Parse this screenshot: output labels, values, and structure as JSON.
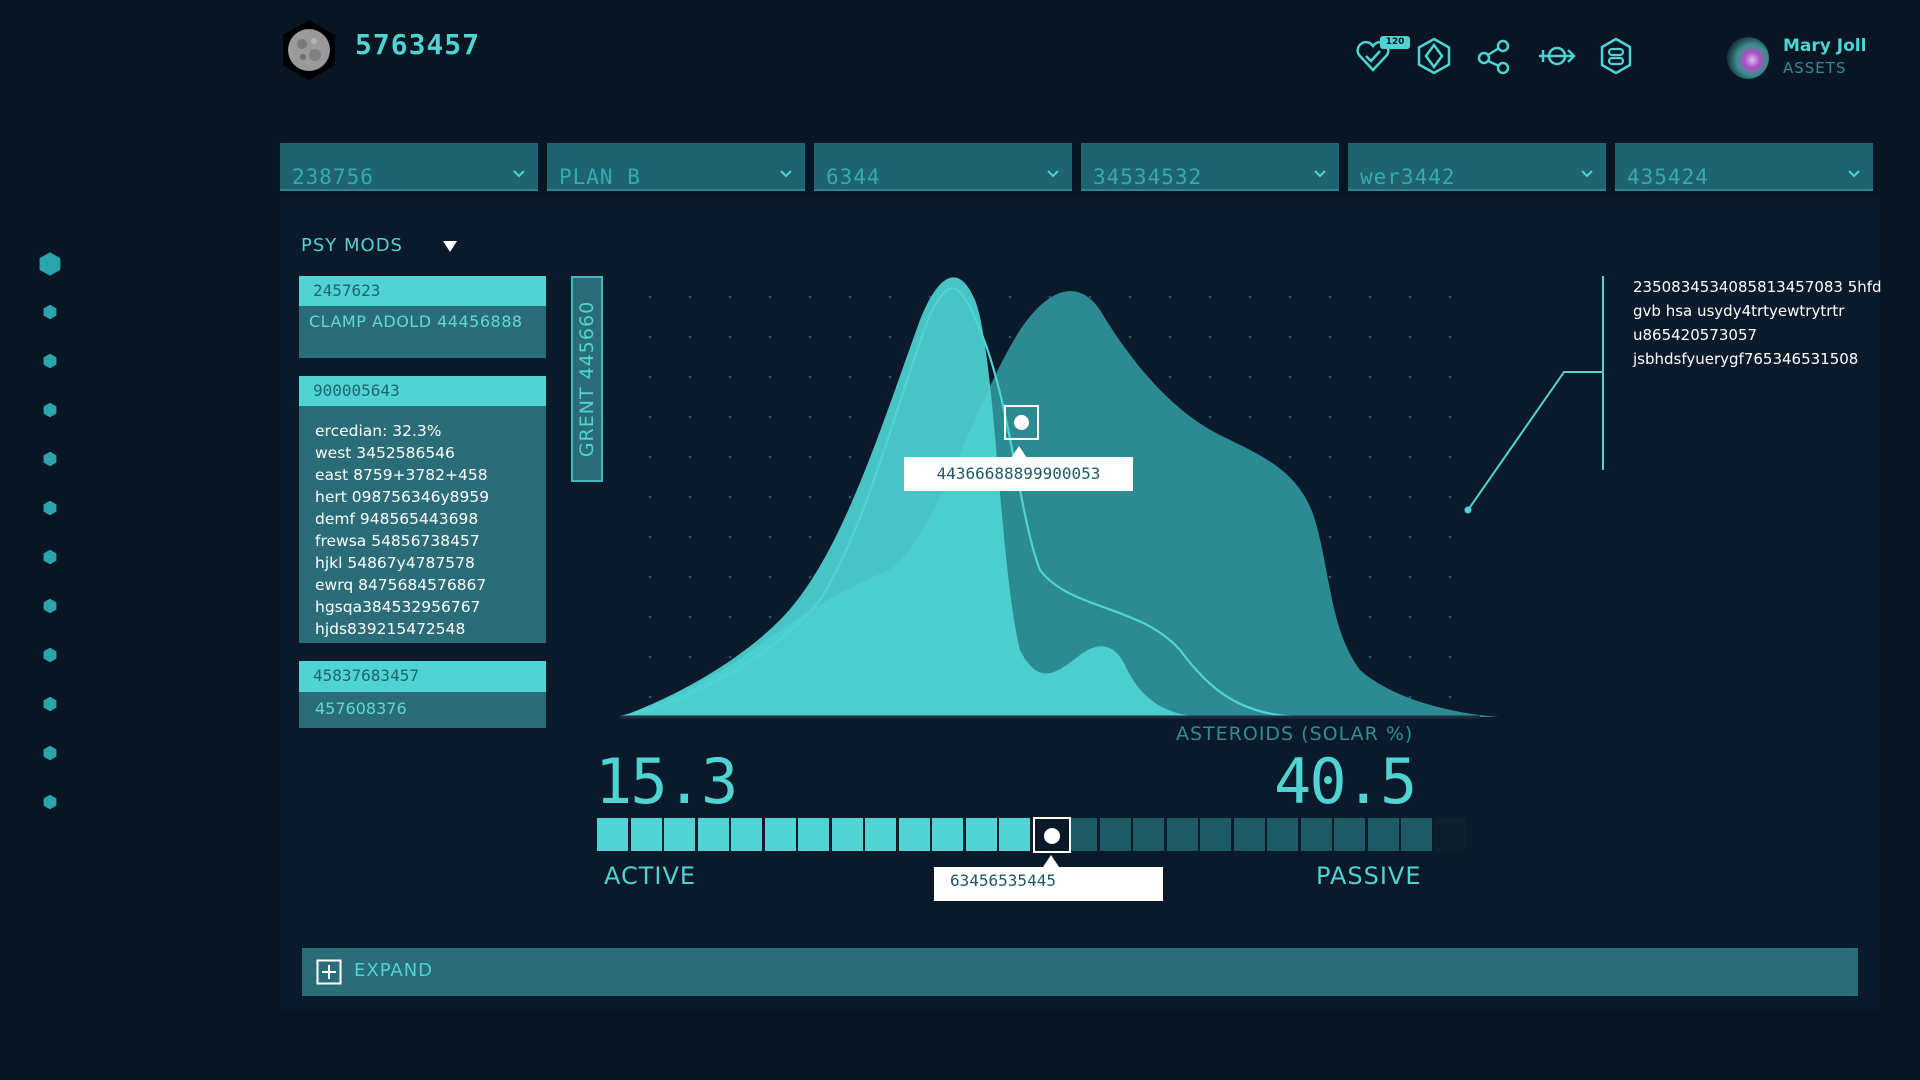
{
  "header": {
    "app_id": "5763457",
    "badge_count": "120",
    "icons": [
      "heart-icon",
      "hexagon-diamond-icon",
      "share-icon",
      "arrow-target-icon",
      "shield-icon"
    ],
    "user_name": "Mary Joll",
    "user_sub": "ASSETS"
  },
  "filters": [
    "238756",
    "PLAN B",
    "6344",
    "34534532",
    "wer3442",
    "435424"
  ],
  "mods": {
    "title": "PSY MODS",
    "card1": {
      "head": "2457623",
      "body": "CLAMP ADOLD 44456888"
    },
    "card2": {
      "head": "900005643",
      "lines": [
        "ercedian: 32.3%",
        "west 3452586546",
        "east 8759+3782+458",
        "hert 098756346y8959",
        "demf 948565443698",
        "frewsa 54856738457",
        "hjkl 54867y4787578",
        "ewrq 8475684576867",
        "hgsqa384532956767",
        "hjds839215472548"
      ]
    },
    "card3": {
      "head": "45837683457",
      "body": "457608376"
    }
  },
  "vertical_tag": "GRENT 445660",
  "chart": {
    "tooltip": "44366688899900053",
    "axis_caption": "ASTEROIDS (SOLAR %)",
    "info_lines": [
      "2350834534085813457083 5hfd",
      "gvb hsa usydy4trtyewtrytrtr",
      "u865420573057",
      "jsbhdsfyuerygf765346531508"
    ],
    "colors": {
      "light": "#4fd3d3",
      "dark": "#2c8a93",
      "grid": "#2a5a6a"
    }
  },
  "range": {
    "left_value": "15.3",
    "right_value": "40.5",
    "left_label": "ACTIVE",
    "right_label": "PASSIVE",
    "tooltip": "63456535445",
    "segments_total": 26,
    "segments_active": 14
  },
  "expand": {
    "label": "EXPAND"
  }
}
